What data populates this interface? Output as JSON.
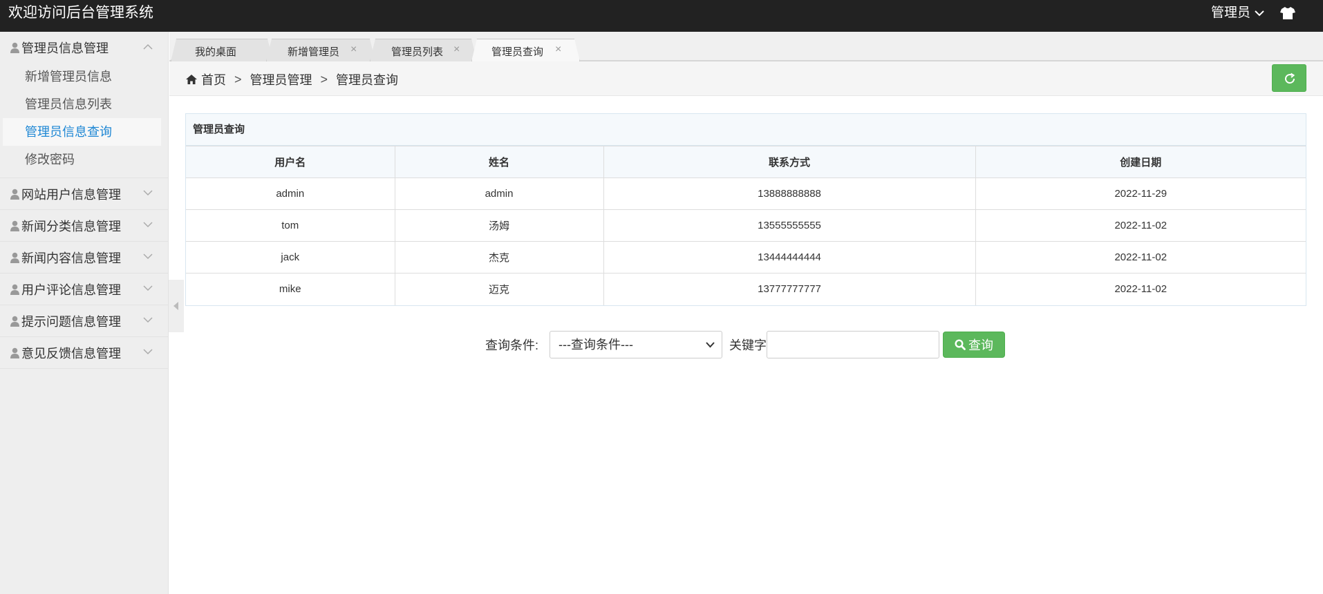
{
  "header": {
    "title": "欢迎访问后台管理系统",
    "user_label": "管理员",
    "user_icon": "chevron-down-icon",
    "theme_icon": "tshirt-icon"
  },
  "sidebar": {
    "groups": [
      {
        "label": "管理员信息管理",
        "expanded": true,
        "items": [
          {
            "label": "新增管理员信息",
            "active": false
          },
          {
            "label": "管理员信息列表",
            "active": false
          },
          {
            "label": "管理员信息查询",
            "active": true
          },
          {
            "label": "修改密码",
            "active": false
          }
        ]
      },
      {
        "label": "网站用户信息管理",
        "expanded": false
      },
      {
        "label": "新闻分类信息管理",
        "expanded": false
      },
      {
        "label": "新闻内容信息管理",
        "expanded": false
      },
      {
        "label": "用户评论信息管理",
        "expanded": false
      },
      {
        "label": "提示问题信息管理",
        "expanded": false
      },
      {
        "label": "意见反馈信息管理",
        "expanded": false
      }
    ]
  },
  "tabs": [
    {
      "label": "我的桌面",
      "closable": false,
      "active": false
    },
    {
      "label": "新增管理员",
      "closable": true,
      "active": false
    },
    {
      "label": "管理员列表",
      "closable": true,
      "active": false
    },
    {
      "label": "管理员查询",
      "closable": true,
      "active": true
    }
  ],
  "tab_close_glyph": "×",
  "breadcrumb": {
    "home": "首页",
    "separator": ">",
    "level1": "管理员管理",
    "level2": "管理员查询"
  },
  "panel": {
    "title": "管理员查询",
    "columns": [
      "用户名",
      "姓名",
      "联系方式",
      "创建日期"
    ],
    "rows": [
      [
        "admin",
        "admin",
        "13888888888",
        "2022-11-29"
      ],
      [
        "tom",
        "汤姆",
        "13555555555",
        "2022-11-02"
      ],
      [
        "jack",
        "杰克",
        "13444444444",
        "2022-11-02"
      ],
      [
        "mike",
        "迈克",
        "13777777777",
        "2022-11-02"
      ]
    ]
  },
  "search": {
    "condition_label": "查询条件:",
    "condition_selected": "---查询条件---",
    "keyword_label": "关键字",
    "keyword_value": "",
    "button_label": "查询"
  },
  "colors": {
    "topbar": "#222222",
    "sidebar": "#eeeeee",
    "accent_green": "#5cb85c",
    "active_link": "#1e87d4"
  }
}
